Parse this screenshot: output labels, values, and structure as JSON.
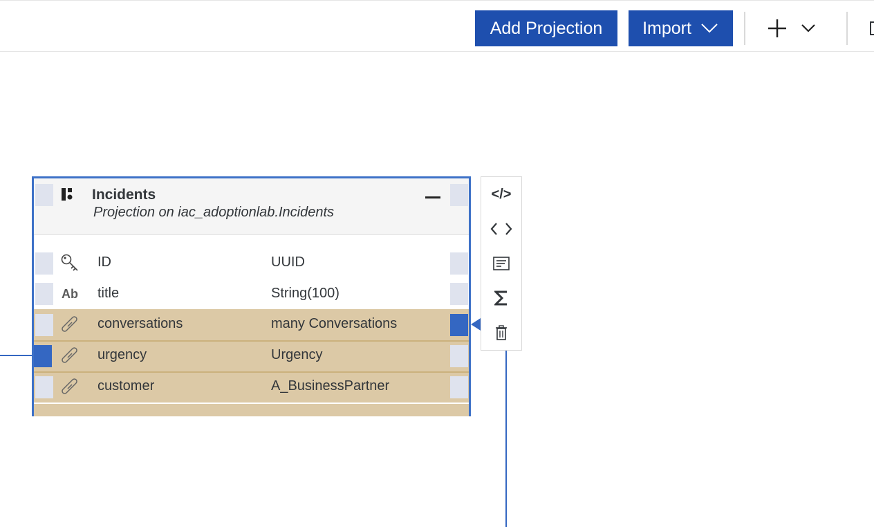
{
  "toolbar": {
    "add_projection_label": "Add Projection",
    "import_label": "Import"
  },
  "entity": {
    "title": "Incidents",
    "subtitle": "Projection on iac_adoptionlab.Incidents",
    "fields": [
      {
        "icon": "key-icon",
        "name": "ID",
        "type": "UUID"
      },
      {
        "icon": "ab-text-icon",
        "icon_text": "Ab",
        "name": "title",
        "type": "String(100)"
      },
      {
        "icon": "link-icon",
        "name": "conversations",
        "type": "many Conversations"
      },
      {
        "icon": "link-icon",
        "name": "urgency",
        "type": "Urgency"
      },
      {
        "icon": "link-icon",
        "name": "customer",
        "type": "A_BusinessPartner"
      }
    ]
  },
  "side_toolbar": {
    "code_label": "</>"
  },
  "colors": {
    "accent": "#1e4fae",
    "entity_border": "#3d71c7",
    "association_row": "#dcc9a6",
    "port": "#dfe3ee",
    "port_active": "#3467c2"
  }
}
